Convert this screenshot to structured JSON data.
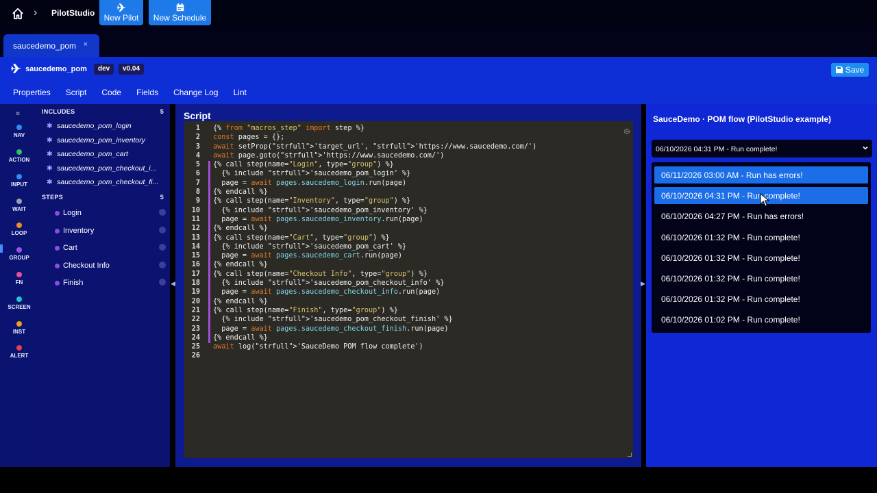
{
  "topbar": {
    "app_name": "PilotStudio",
    "new_pilot_label": "New Pilot",
    "new_schedule_label": "New Schedule"
  },
  "tab": {
    "label": "saucedemo_pom",
    "close": "×"
  },
  "header": {
    "project_name": "saucedemo_pom",
    "env_badge": "dev",
    "version_badge": "v0.04",
    "save_label": "Save",
    "nav_tabs": [
      "Properties",
      "Script",
      "Code",
      "Fields",
      "Change Log",
      "Lint"
    ]
  },
  "rail": {
    "collapse": "«",
    "items": [
      {
        "label": "NAV",
        "color": "#2f8cf2"
      },
      {
        "label": "ACTION",
        "color": "#2ec15f"
      },
      {
        "label": "INPUT",
        "color": "#2f8cf2"
      },
      {
        "label": "WAIT",
        "color": "#9aa0b0"
      },
      {
        "label": "LOOP",
        "color": "#f08a22"
      },
      {
        "label": "GROUP",
        "color": "#9a54e6"
      },
      {
        "label": "FN",
        "color": "#e94fa0"
      },
      {
        "label": "SCREEN",
        "color": "#22c6cf"
      },
      {
        "label": "INST",
        "color": "#f0a020"
      },
      {
        "label": "ALERT",
        "color": "#e8404a"
      }
    ]
  },
  "explorer": {
    "includes_title": "INCLUDES",
    "includes_count": "5",
    "includes": [
      "saucedemo_pom_login",
      "saucedemo_pom_inventory",
      "saucedemo_pom_cart",
      "saucedemo_pom_checkout_i...",
      "saucedemo_pom_checkout_fi..."
    ],
    "steps_title": "STEPS",
    "steps_count": "5",
    "steps": [
      "Login",
      "Inventory",
      "Cart",
      "Checkout Info",
      "Finish"
    ]
  },
  "script": {
    "title": "Script",
    "lines": [
      "{% from \"macros_step\" import step %}",
      "const pages = {};",
      "await setProp('target_url', 'https://www.saucedemo.com/')",
      "await page.goto('https://www.saucedemo.com/')",
      "{% call step(name=\"Login\", type=\"group\") %}",
      "  {% include 'saucedemo_pom_login' %}",
      "  page = await pages.saucedemo_login.run(page)",
      "{% endcall %}",
      "{% call step(name=\"Inventory\", type=\"group\") %}",
      "  {% include 'saucedemo_pom_inventory' %}",
      "  page = await pages.saucedemo_inventory.run(page)",
      "{% endcall %}",
      "{% call step(name=\"Cart\", type=\"group\") %}",
      "  {% include 'saucedemo_pom_cart' %}",
      "  page = await pages.saucedemo_cart.run(page)",
      "{% endcall %}",
      "{% call step(name=\"Checkout Info\", type=\"group\") %}",
      "  {% include 'saucedemo_pom_checkout_info' %}",
      "  page = await pages.saucedemo_checkout_info.run(page)",
      "{% endcall %}",
      "{% call step(name=\"Finish\", type=\"group\") %}",
      "  {% include 'saucedemo_pom_checkout_finish' %}",
      "  page = await pages.saucedemo_checkout_finish.run(page)",
      "{% endcall %}",
      "await log('SauceDemo POM flow complete')",
      ""
    ],
    "marked_lines": [
      5,
      6,
      7,
      8,
      9,
      10,
      11,
      12,
      13,
      14,
      15,
      16,
      17,
      18,
      19,
      20,
      21,
      22,
      23,
      24
    ]
  },
  "run_panel": {
    "title": "SauceDemo · POM flow (PilotStudio example)",
    "selected_run": "06/10/2026 04:31 PM - Run complete!",
    "runs": [
      "06/11/2026 03:00 AM - Run has errors!",
      "06/10/2026 04:31 PM - Run complete!",
      "06/10/2026 04:27 PM - Run has errors!",
      "06/10/2026 01:32 PM - Run complete!",
      "06/10/2026 01:32 PM - Run complete!",
      "06/10/2026 01:32 PM - Run complete!",
      "06/10/2026 01:32 PM - Run complete!",
      "06/10/2026 01:02 PM - Run complete!"
    ],
    "highlighted": [
      0,
      1
    ]
  }
}
